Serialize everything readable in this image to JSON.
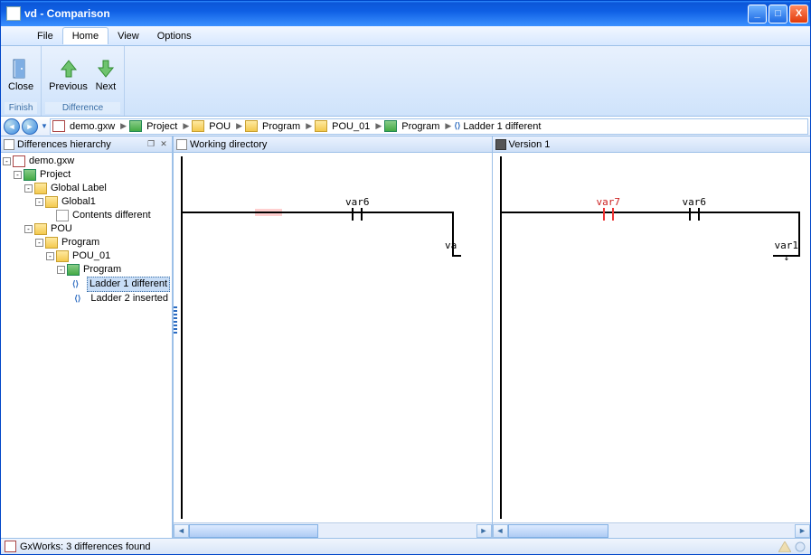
{
  "window": {
    "title": "vd - Comparison"
  },
  "menu": {
    "file": "File",
    "home": "Home",
    "view": "View",
    "options": "Options"
  },
  "ribbon": {
    "close": "Close",
    "previous": "Previous",
    "next": "Next",
    "group_finish": "Finish",
    "group_diff": "Difference"
  },
  "breadcrumb": {
    "items": [
      "demo.gxw",
      "Project",
      "POU",
      "Program",
      "POU_01",
      "Program",
      "Ladder 1 different"
    ]
  },
  "panes": {
    "tree_title": "Differences hierarchy",
    "left_title": "Working directory",
    "right_title": "Version 1"
  },
  "tree": {
    "root": "demo.gxw",
    "project": "Project",
    "global_label": "Global Label",
    "global1": "Global1",
    "contents_diff": "Contents different",
    "pou": "POU",
    "program": "Program",
    "pou01": "POU_01",
    "program2": "Program",
    "ladder1": "Ladder 1 different",
    "ladder2": "Ladder 2 inserted"
  },
  "ladder": {
    "left": {
      "contacts": [
        {
          "name": "var6"
        }
      ],
      "out": "va"
    },
    "right": {
      "contacts": [
        {
          "name": "var7",
          "diff": true
        },
        {
          "name": "var6"
        }
      ],
      "out": "var1"
    }
  },
  "status": {
    "text": "GxWorks: 3 differences found"
  }
}
